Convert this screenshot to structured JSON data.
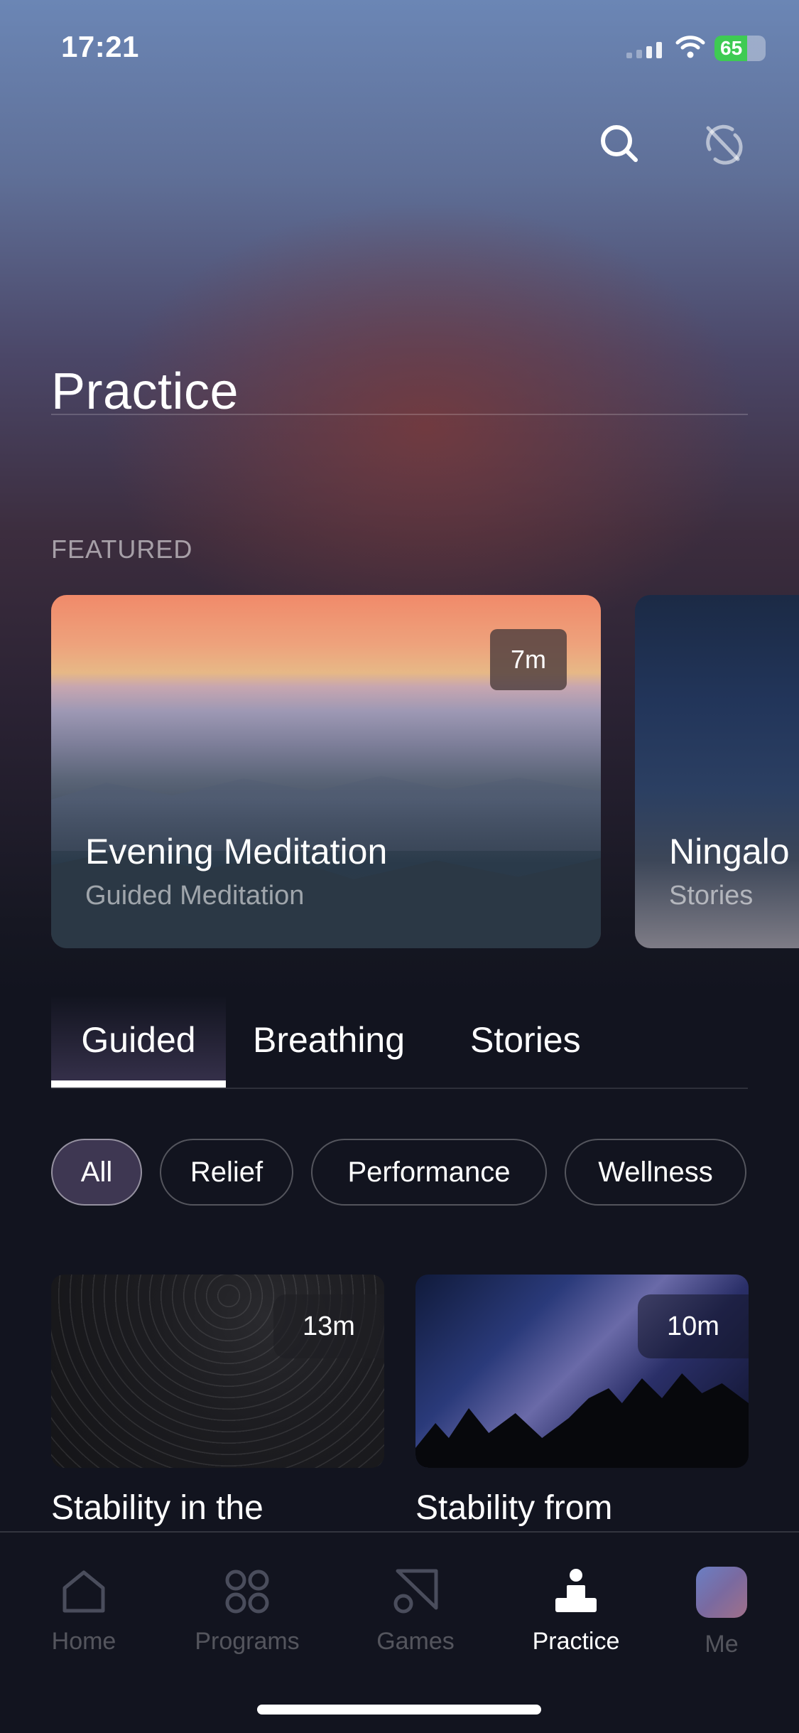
{
  "status_bar": {
    "time": "17:21",
    "battery": "65"
  },
  "header": {
    "title": "Practice"
  },
  "featured": {
    "section_label": "FEATURED",
    "cards": [
      {
        "title": "Evening Meditation",
        "subtitle": "Guided Meditation",
        "duration": "7m"
      },
      {
        "title": "Ningalo",
        "subtitle": "Stories"
      }
    ]
  },
  "tabs": [
    {
      "label": "Guided",
      "selected": true
    },
    {
      "label": "Breathing",
      "selected": false
    },
    {
      "label": "Stories",
      "selected": false
    }
  ],
  "filters": [
    {
      "label": "All",
      "selected": true
    },
    {
      "label": "Relief",
      "selected": false
    },
    {
      "label": "Performance",
      "selected": false
    },
    {
      "label": "Wellness",
      "selected": false
    }
  ],
  "sessions": [
    {
      "title": "Stability in the",
      "duration": "13m"
    },
    {
      "title": "Stability from",
      "duration": "10m"
    }
  ],
  "tab_bar": {
    "items": [
      {
        "label": "Home",
        "icon": "home-icon",
        "active": false
      },
      {
        "label": "Programs",
        "icon": "programs-icon",
        "active": false
      },
      {
        "label": "Games",
        "icon": "games-icon",
        "active": false
      },
      {
        "label": "Practice",
        "icon": "practice-icon",
        "active": true
      },
      {
        "label": "Me",
        "icon": "avatar",
        "active": false
      }
    ]
  },
  "colors": {
    "background": "#12141f",
    "active_tab": "#ffffff",
    "inactive_nav": "#4a4d5c",
    "battery_green": "#3ecb53"
  }
}
